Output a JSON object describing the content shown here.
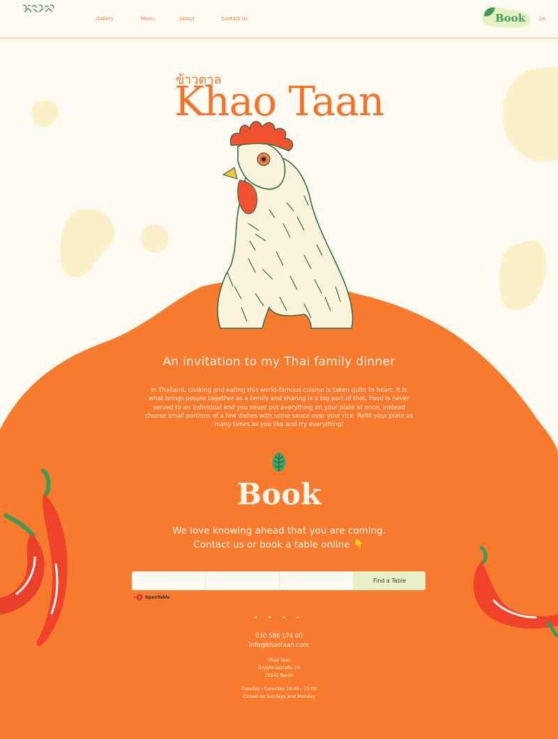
{
  "header": {
    "logo_text": "ข้าวตาล",
    "nav": [
      "Gallery",
      "Menu",
      "About",
      "Contact Us"
    ],
    "book_button": "Book",
    "language": "DE"
  },
  "hero": {
    "thai_title": "ข้าวตาล",
    "brand_title": "Khao Taan"
  },
  "intro": {
    "heading": "An invitation to my Thai family dinner",
    "body": "In Thailand, cooking and eating this world-famous cuisine is taken quite to heart. It is what brings people together as a family and sharing is a big part of that. Food is never served to an individual and you never put everything on your plate at once. Instead choose small portions of a few dishes with some sauce over your rice. Refill your plate as many times as you like and try everything!"
  },
  "booking": {
    "title": "Book",
    "line1": "We love knowing ahead that you are coming.",
    "line2": "Contact us or book a table online 👇",
    "find_button": "Find a Table",
    "opentable_label": "OpenTable"
  },
  "footer": {
    "dots": "• • • •",
    "phone": "030 586 174 00",
    "email": "info@khaotaan.com",
    "address": [
      "Khao Taan",
      "Gryphiusstraße 10",
      "10245 Berlin"
    ],
    "hours": [
      "Tuesday - Saturday 18:00 - 23:00",
      "Closed on Sundays and Monday"
    ]
  },
  "colors": {
    "background": "#fdfbf1",
    "orange": "#f77a2e",
    "title_orange": "#f4722b",
    "leaf_green": "#3f9b5a",
    "find_button": "#e8f0c8"
  },
  "icons": [
    "logo",
    "leaf-icon",
    "rooster-illustration",
    "chili-illustration",
    "opentable-icon"
  ]
}
